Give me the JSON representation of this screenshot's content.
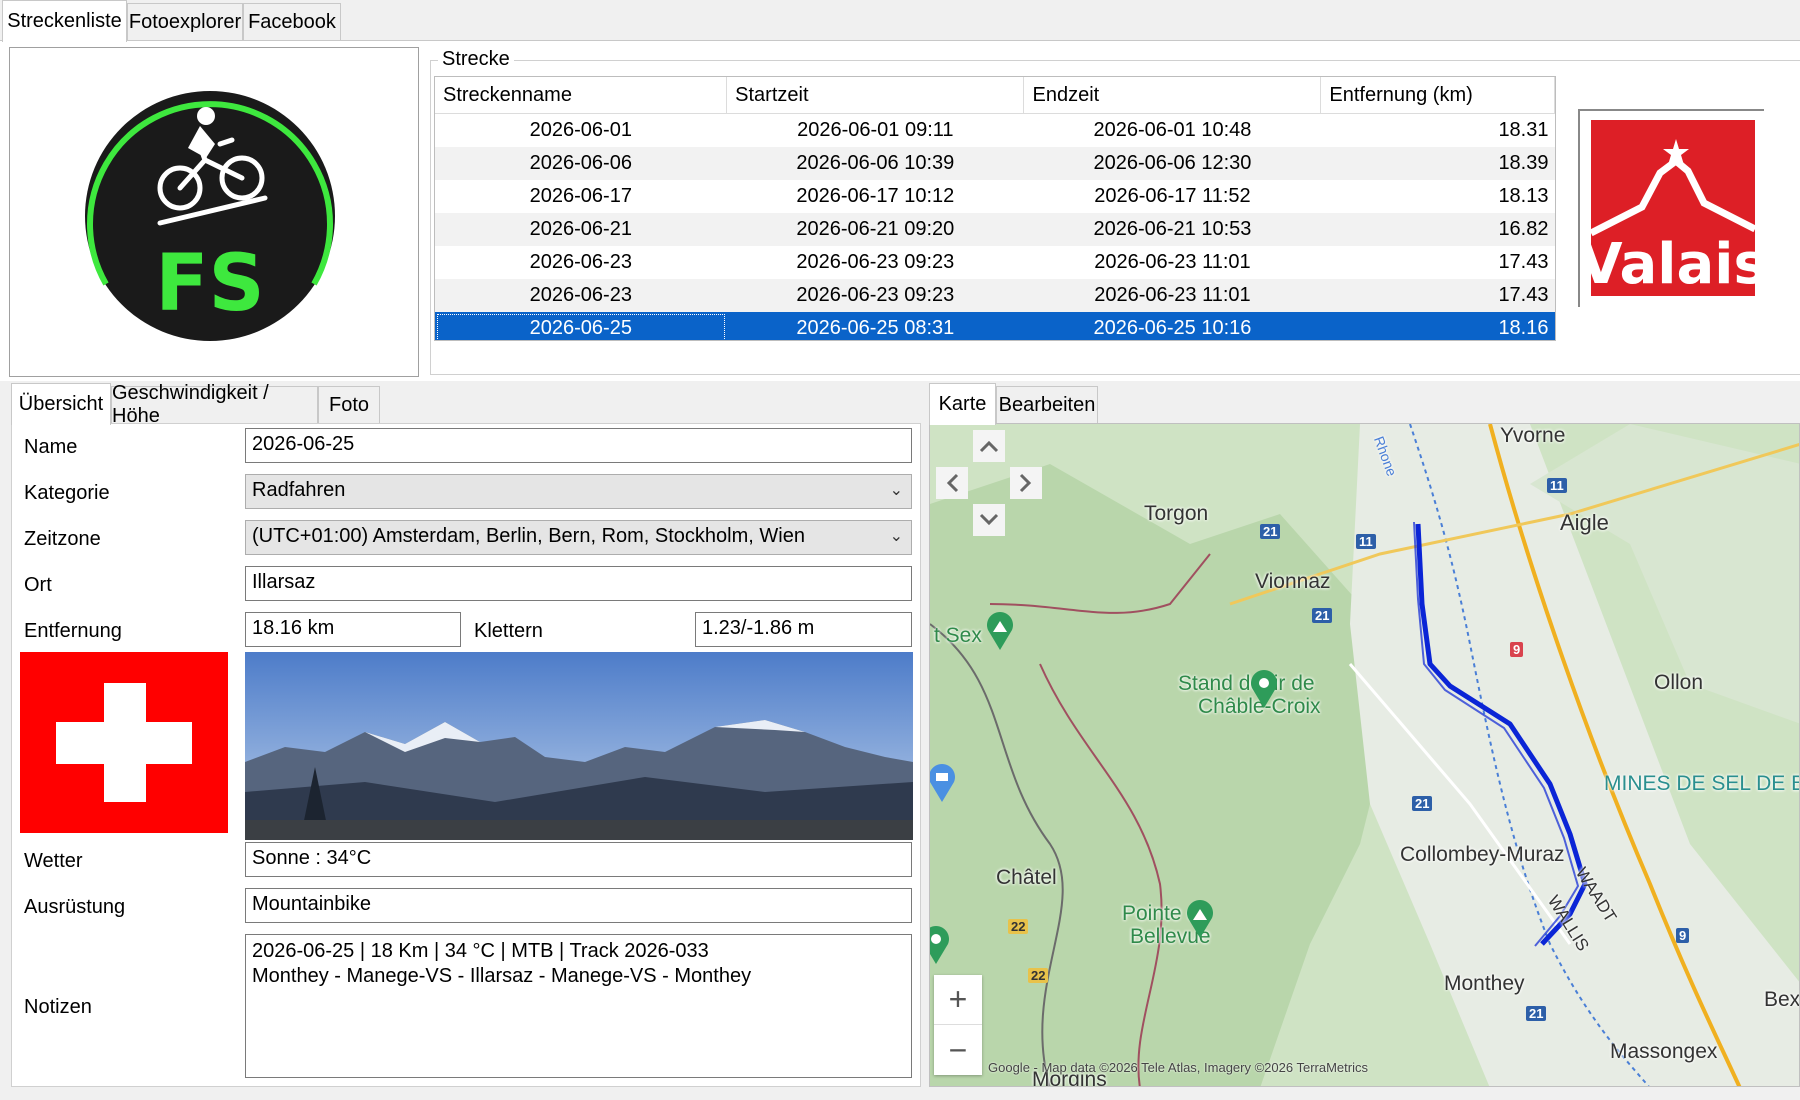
{
  "top_tabs": [
    "Streckenliste",
    "Fotoexplorer",
    "Facebook"
  ],
  "strecke": {
    "group_title": "Strecke",
    "columns": [
      "Streckenname",
      "Startzeit",
      "Endzeit",
      "Entfernung (km)"
    ],
    "rows": [
      {
        "name": "2026-06-01",
        "start": "2026-06-01 09:11",
        "end": "2026-06-01 10:48",
        "dist": "18.31"
      },
      {
        "name": "2026-06-06",
        "start": "2026-06-06 10:39",
        "end": "2026-06-06 12:30",
        "dist": "18.39"
      },
      {
        "name": "2026-06-17",
        "start": "2026-06-17 10:12",
        "end": "2026-06-17 11:52",
        "dist": "18.13"
      },
      {
        "name": "2026-06-21",
        "start": "2026-06-21 09:20",
        "end": "2026-06-21 10:53",
        "dist": "16.82"
      },
      {
        "name": "2026-06-23",
        "start": "2026-06-23 09:23",
        "end": "2026-06-23 11:01",
        "dist": "17.43"
      },
      {
        "name": "2026-06-23",
        "start": "2026-06-23 09:23",
        "end": "2026-06-23 11:01",
        "dist": "17.43"
      },
      {
        "name": "2026-06-25",
        "start": "2026-06-25 08:31",
        "end": "2026-06-25 10:16",
        "dist": "18.16"
      }
    ],
    "selected_row": 6
  },
  "logos": {
    "app_letters": "FS",
    "valais_text": "Valais"
  },
  "detail_tabs": [
    "Übersicht",
    "Geschwindigkeit / Höhe",
    "Foto"
  ],
  "form": {
    "name_label": "Name",
    "name_value": "2026-06-25",
    "kategorie_label": "Kategorie",
    "kategorie_value": "Radfahren",
    "zeitzone_label": "Zeitzone",
    "zeitzone_value": "(UTC+01:00) Amsterdam, Berlin, Bern, Rom, Stockholm, Wien",
    "ort_label": "Ort",
    "ort_value": "Illarsaz",
    "entfernung_label": "Entfernung",
    "entfernung_value": "18.16 km",
    "klettern_label": "Klettern",
    "klettern_value": "1.23/-1.86 m",
    "wetter_label": "Wetter",
    "wetter_value": "Sonne  :  34°C",
    "ausruestung_label": "Ausrüstung",
    "ausruestung_value": "Mountainbike",
    "notizen_label": "Notizen",
    "notizen_line1": "2026-06-25  |  18 Km  |  34 °C  |  MTB  |  Track 2026-033",
    "notizen_line2": "Monthey - Manege-VS - Illarsaz - Manege-VS - Monthey"
  },
  "map_tabs": [
    "Karte",
    "Bearbeiten"
  ],
  "map": {
    "labels": {
      "yvorne": "Yvorne",
      "aigle": "Aigle",
      "torgon": "Torgon",
      "vionnaz": "Vionnaz",
      "sex": "t Sex",
      "stand": "Stand de tir de",
      "chable": "Châble-Croix",
      "ollon": "Ollon",
      "mines": "MINES DE SEL DE BE",
      "collombey": "Collombey-Muraz",
      "waadt": "WAADT",
      "wallis": "WALLIS",
      "chatel": "Châtel",
      "pointe": "Pointe de",
      "bellevue": "Bellevue",
      "monthey": "Monthey",
      "bex": "Bex",
      "massongex": "Massongex",
      "morgins": "Morgins",
      "rhone": "Rhone"
    },
    "road_shields": [
      "11",
      "21",
      "11",
      "21",
      "9",
      "21",
      "22",
      "22",
      "21",
      "9"
    ],
    "attribution": "Google - Map data ©2026 Tele Atlas, Imagery ©2026 TerraMetrics",
    "zoom_in": "+",
    "zoom_out": "−"
  }
}
